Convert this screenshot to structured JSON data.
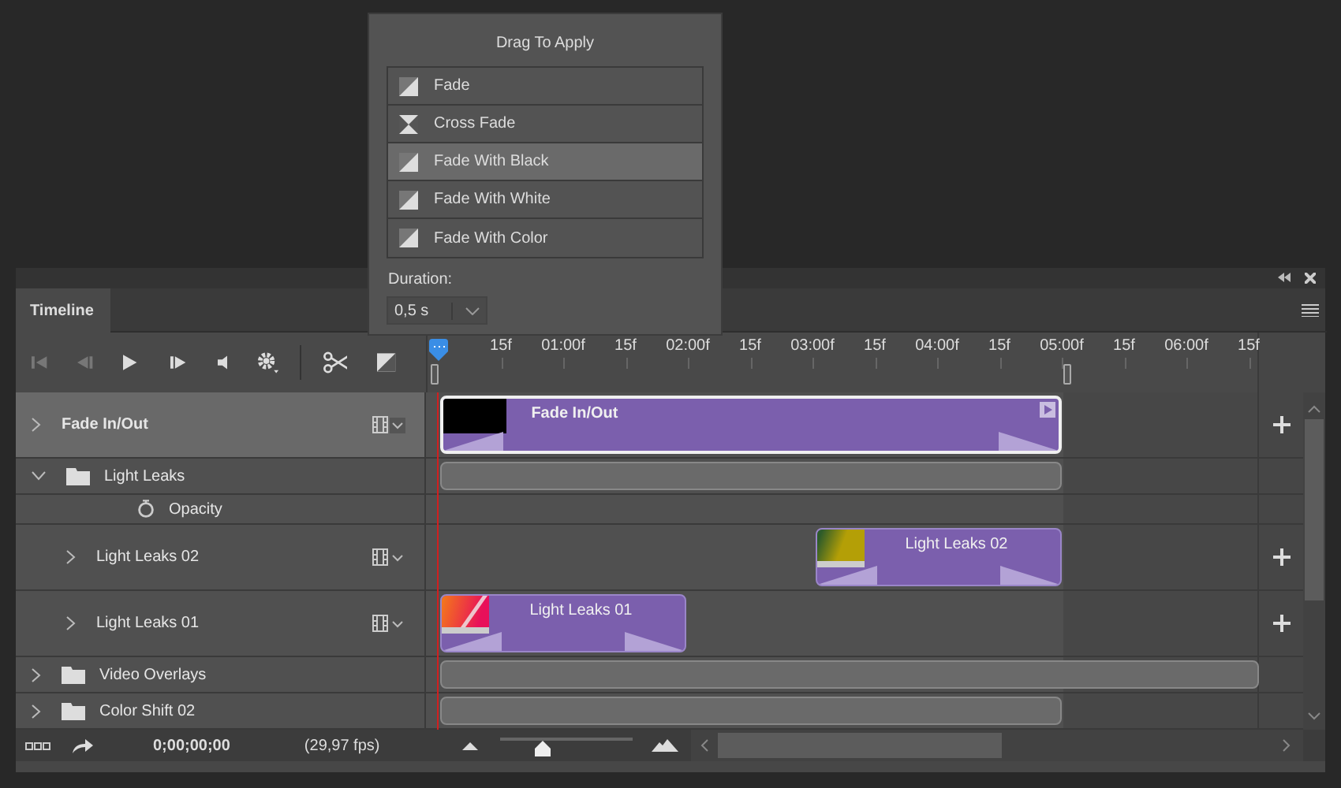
{
  "popup": {
    "title": "Drag To Apply",
    "transitions": [
      {
        "label": "Fade",
        "kind": "fade",
        "selected": false
      },
      {
        "label": "Cross Fade",
        "kind": "cross",
        "selected": false
      },
      {
        "label": "Fade With Black",
        "kind": "fade",
        "selected": true
      },
      {
        "label": "Fade With White",
        "kind": "fade",
        "selected": false
      },
      {
        "label": "Fade With Color",
        "kind": "fade",
        "selected": false
      }
    ],
    "duration_label": "Duration:",
    "duration_value": "0,5 s"
  },
  "panel": {
    "tab": "Timeline"
  },
  "ruler": [
    "15f",
    "01:00f",
    "15f",
    "02:00f",
    "15f",
    "03:00f",
    "15f",
    "04:00f",
    "15f",
    "05:00f",
    "15f",
    "06:00f",
    "15f"
  ],
  "tracks": [
    {
      "name": "Fade In/Out",
      "kind": "video",
      "selected": true,
      "expanded": false,
      "clip": "Fade In/Out"
    },
    {
      "name": "Light Leaks",
      "kind": "group",
      "selected": false,
      "expanded": true,
      "children": [
        {
          "name": "Opacity",
          "kind": "property"
        },
        {
          "name": "Light Leaks 02",
          "kind": "video",
          "selected": false,
          "expanded": false,
          "clip": "Light Leaks 02"
        },
        {
          "name": "Light Leaks 01",
          "kind": "video",
          "selected": false,
          "expanded": false,
          "clip": "Light Leaks 01"
        }
      ]
    },
    {
      "name": "Video Overlays",
      "kind": "group",
      "selected": false,
      "expanded": false
    },
    {
      "name": "Color Shift 02",
      "kind": "group",
      "selected": false,
      "expanded": false
    }
  ],
  "status": {
    "timecode": "0;00;00;00",
    "fps": "(29,97 fps)"
  },
  "zoom": {
    "level": 0.25
  }
}
